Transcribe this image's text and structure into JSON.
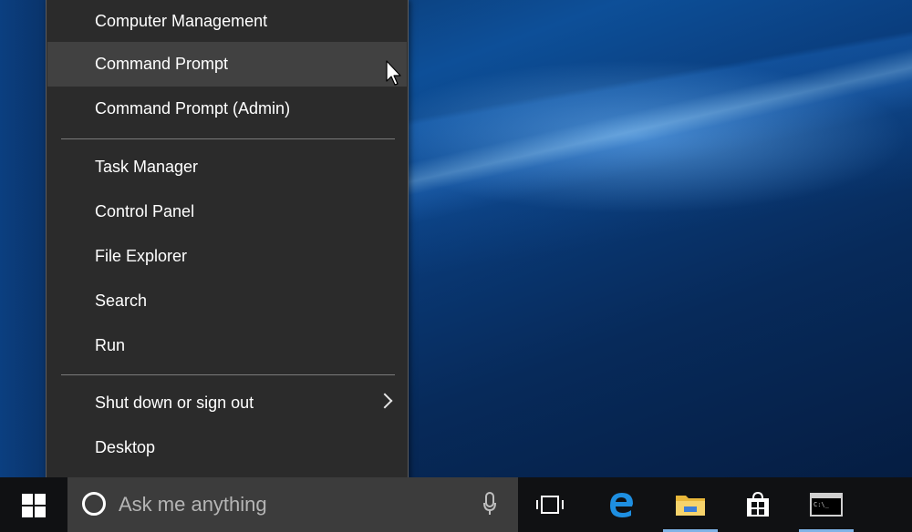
{
  "desktop": {
    "accent_color": "#0d4f98"
  },
  "context_menu": {
    "items_group1": [
      {
        "label": "Computer Management"
      },
      {
        "label": "Command Prompt",
        "hovered": true
      },
      {
        "label": "Command Prompt (Admin)"
      }
    ],
    "items_group2": [
      {
        "label": "Task Manager"
      },
      {
        "label": "Control Panel"
      },
      {
        "label": "File Explorer"
      },
      {
        "label": "Search"
      },
      {
        "label": "Run"
      }
    ],
    "items_group3": [
      {
        "label": "Shut down or sign out",
        "has_submenu": true
      },
      {
        "label": "Desktop"
      }
    ]
  },
  "taskbar": {
    "start_icon": "windows-logo-icon",
    "search": {
      "placeholder": "Ask me anything",
      "left_icon": "cortana-icon",
      "right_icon": "microphone-icon"
    },
    "icons": [
      {
        "name": "task-view-icon",
        "running": false
      },
      {
        "name": "edge-icon",
        "running": false
      },
      {
        "name": "file-explorer-icon",
        "running": true
      },
      {
        "name": "store-icon",
        "running": false
      },
      {
        "name": "command-prompt-icon",
        "running": true
      }
    ],
    "running_indicator_color": "#7fb3e6"
  }
}
